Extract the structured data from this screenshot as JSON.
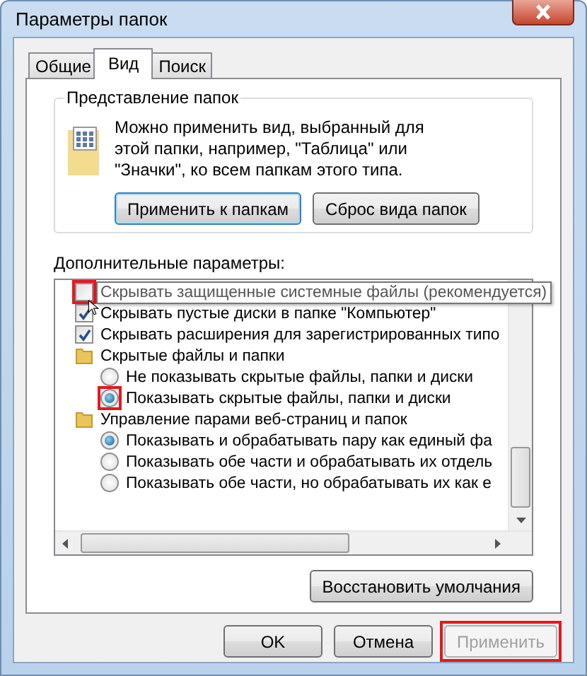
{
  "window": {
    "title": "Параметры папок"
  },
  "tabs": [
    {
      "label": "Общие",
      "selected": false
    },
    {
      "label": "Вид",
      "selected": true
    },
    {
      "label": "Поиск",
      "selected": false
    }
  ],
  "folder_views": {
    "title": "Представление папок",
    "description": "Можно применить вид, выбранный для этой папки, например, \"Таблица\" или \"Значки\", ко всем папкам этого типа.",
    "buttons": [
      {
        "label": "Применить к папкам",
        "focused": true
      },
      {
        "label": "Сброс вида папок",
        "focused": false
      }
    ]
  },
  "advanced": {
    "title": "Дополнительные параметры:",
    "items": [
      {
        "kind": "checkbox",
        "label": "Скрывать защищенные системные файлы (рекомендуется)",
        "checked": false,
        "hovered": true,
        "highlighted": true
      },
      {
        "kind": "checkbox",
        "label": "Скрывать пустые диски в папке \"Компьютер\"",
        "checked": true,
        "hovered": false,
        "highlighted": false
      },
      {
        "kind": "checkbox",
        "label": "Скрывать расширения для зарегистрированных типо",
        "checked": true,
        "hovered": false,
        "highlighted": false
      },
      {
        "kind": "folder",
        "label": "Скрытые файлы и папки",
        "children": [
          {
            "kind": "radio",
            "label": "Не показывать скрытые файлы, папки и диски",
            "checked": false,
            "hovered": false,
            "highlighted": false
          },
          {
            "kind": "radio",
            "label": "Показывать скрытые файлы, папки и диски",
            "checked": true,
            "hovered": false,
            "highlighted": true
          }
        ]
      },
      {
        "kind": "folder",
        "label": "Управление парами веб-страниц и папок",
        "children": [
          {
            "kind": "radio",
            "label": "Показывать и обрабатывать пару как единый фа",
            "checked": true,
            "hovered": false,
            "highlighted": false
          },
          {
            "kind": "radio",
            "label": "Показывать обе части и обрабатывать их отдель",
            "checked": false,
            "hovered": false,
            "highlighted": false
          },
          {
            "kind": "radio",
            "label": "Показывать обе части, но обрабатывать их как е",
            "checked": false,
            "hovered": false,
            "highlighted": false
          }
        ]
      }
    ],
    "restore_button": "Восстановить умолчания"
  },
  "buttons": [
    {
      "label": "OK",
      "disabled": false,
      "highlighted": false
    },
    {
      "label": "Отмена",
      "disabled": false,
      "highlighted": false
    },
    {
      "label": "Применить",
      "disabled": true,
      "highlighted": true
    }
  ]
}
